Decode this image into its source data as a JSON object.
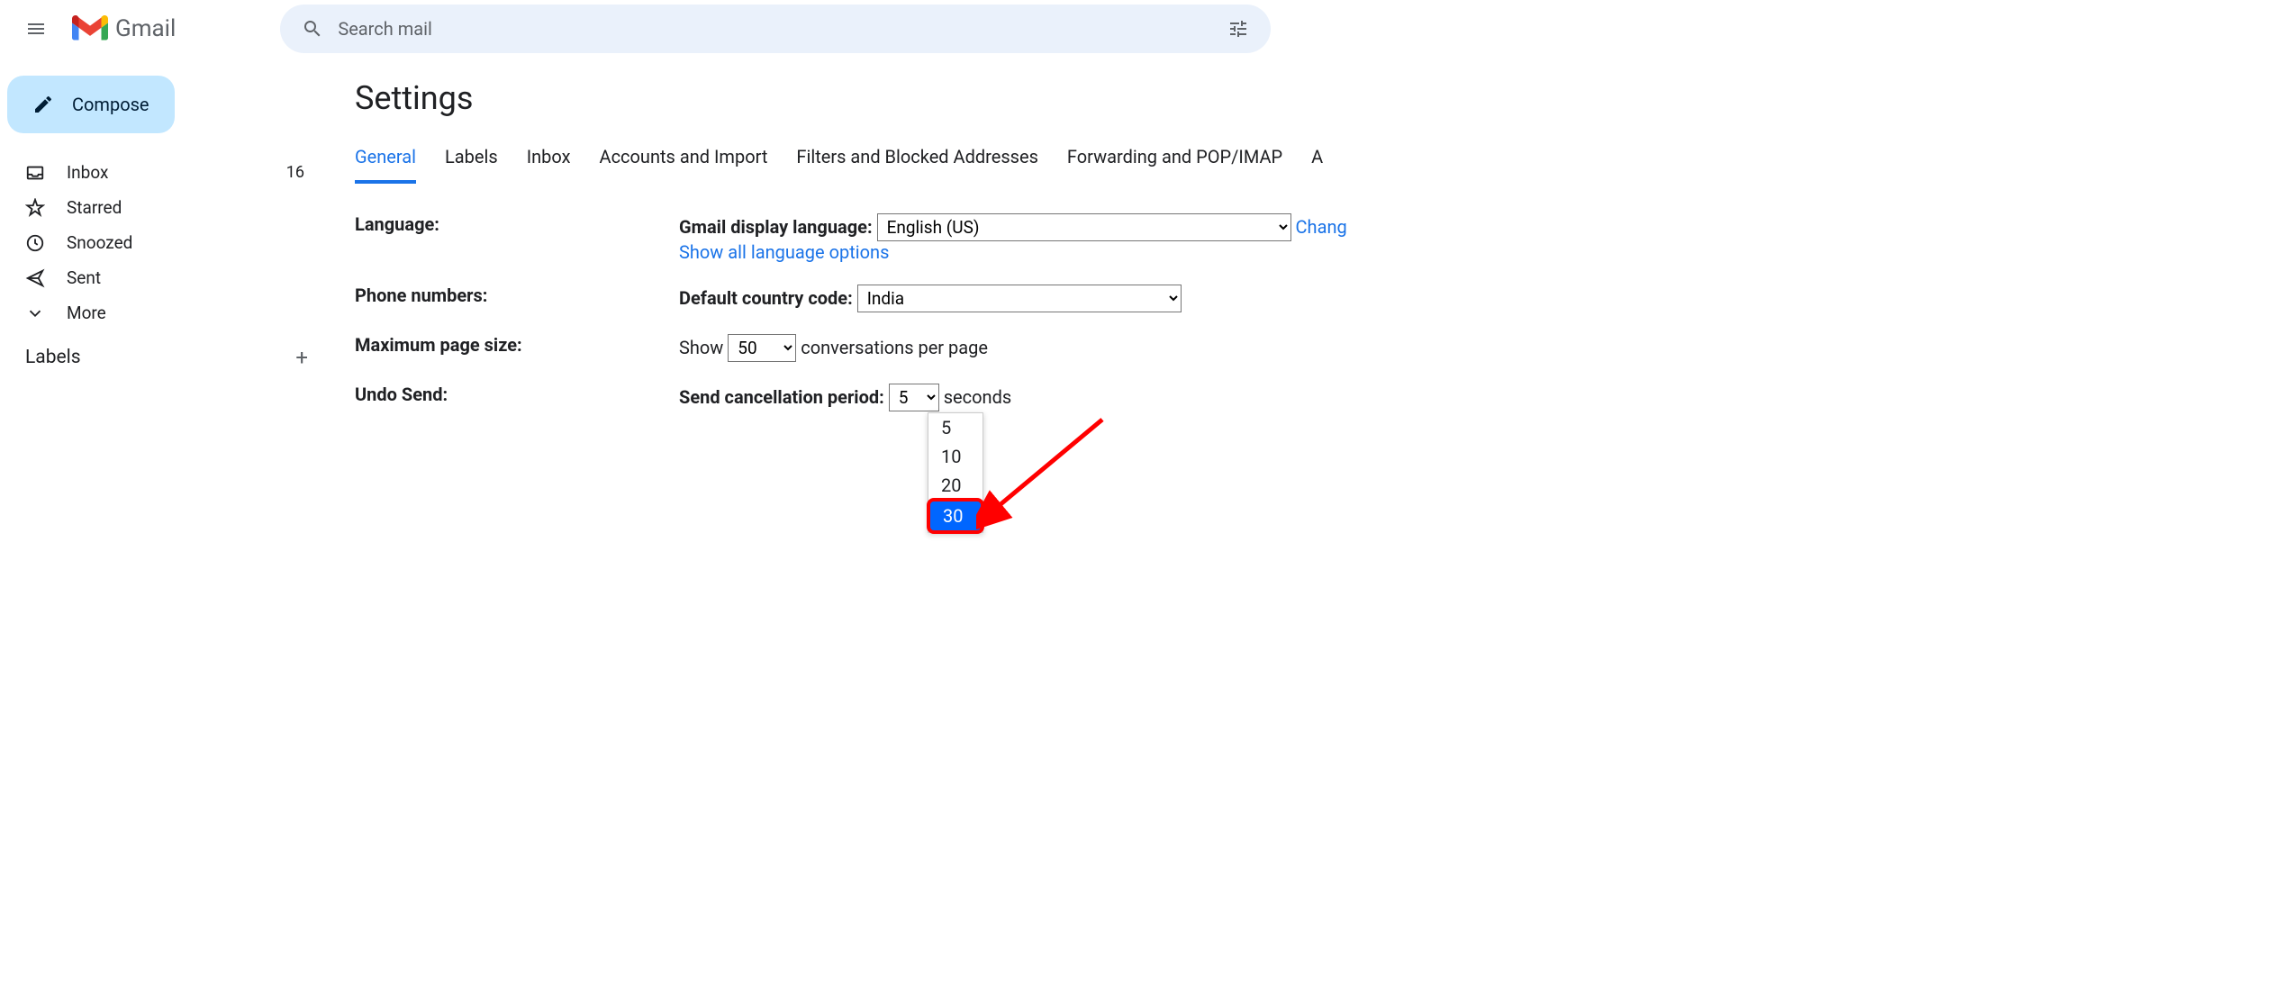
{
  "header": {
    "app_name": "Gmail",
    "search_placeholder": "Search mail"
  },
  "sidebar": {
    "compose_label": "Compose",
    "items": [
      {
        "label": "Inbox",
        "count": "16"
      },
      {
        "label": "Starred",
        "count": ""
      },
      {
        "label": "Snoozed",
        "count": ""
      },
      {
        "label": "Sent",
        "count": ""
      },
      {
        "label": "More",
        "count": ""
      }
    ],
    "labels_header": "Labels"
  },
  "settings": {
    "title": "Settings",
    "tabs": [
      "General",
      "Labels",
      "Inbox",
      "Accounts and Import",
      "Filters and Blocked Addresses",
      "Forwarding and POP/IMAP",
      "A"
    ],
    "language": {
      "label": "Language:",
      "display_label": "Gmail display language:",
      "selected": "English (US)",
      "change_link": "Chang",
      "show_all": "Show all language options"
    },
    "phone": {
      "label": "Phone numbers:",
      "country_label": "Default country code:",
      "selected": "India"
    },
    "pagesize": {
      "label": "Maximum page size:",
      "show_prefix": "Show",
      "selected": "50",
      "suffix": "conversations per page"
    },
    "undo": {
      "label": "Undo Send:",
      "period_label": "Send cancellation period:",
      "selected": "5",
      "suffix": "seconds",
      "options": [
        "5",
        "10",
        "20",
        "30"
      ]
    }
  }
}
